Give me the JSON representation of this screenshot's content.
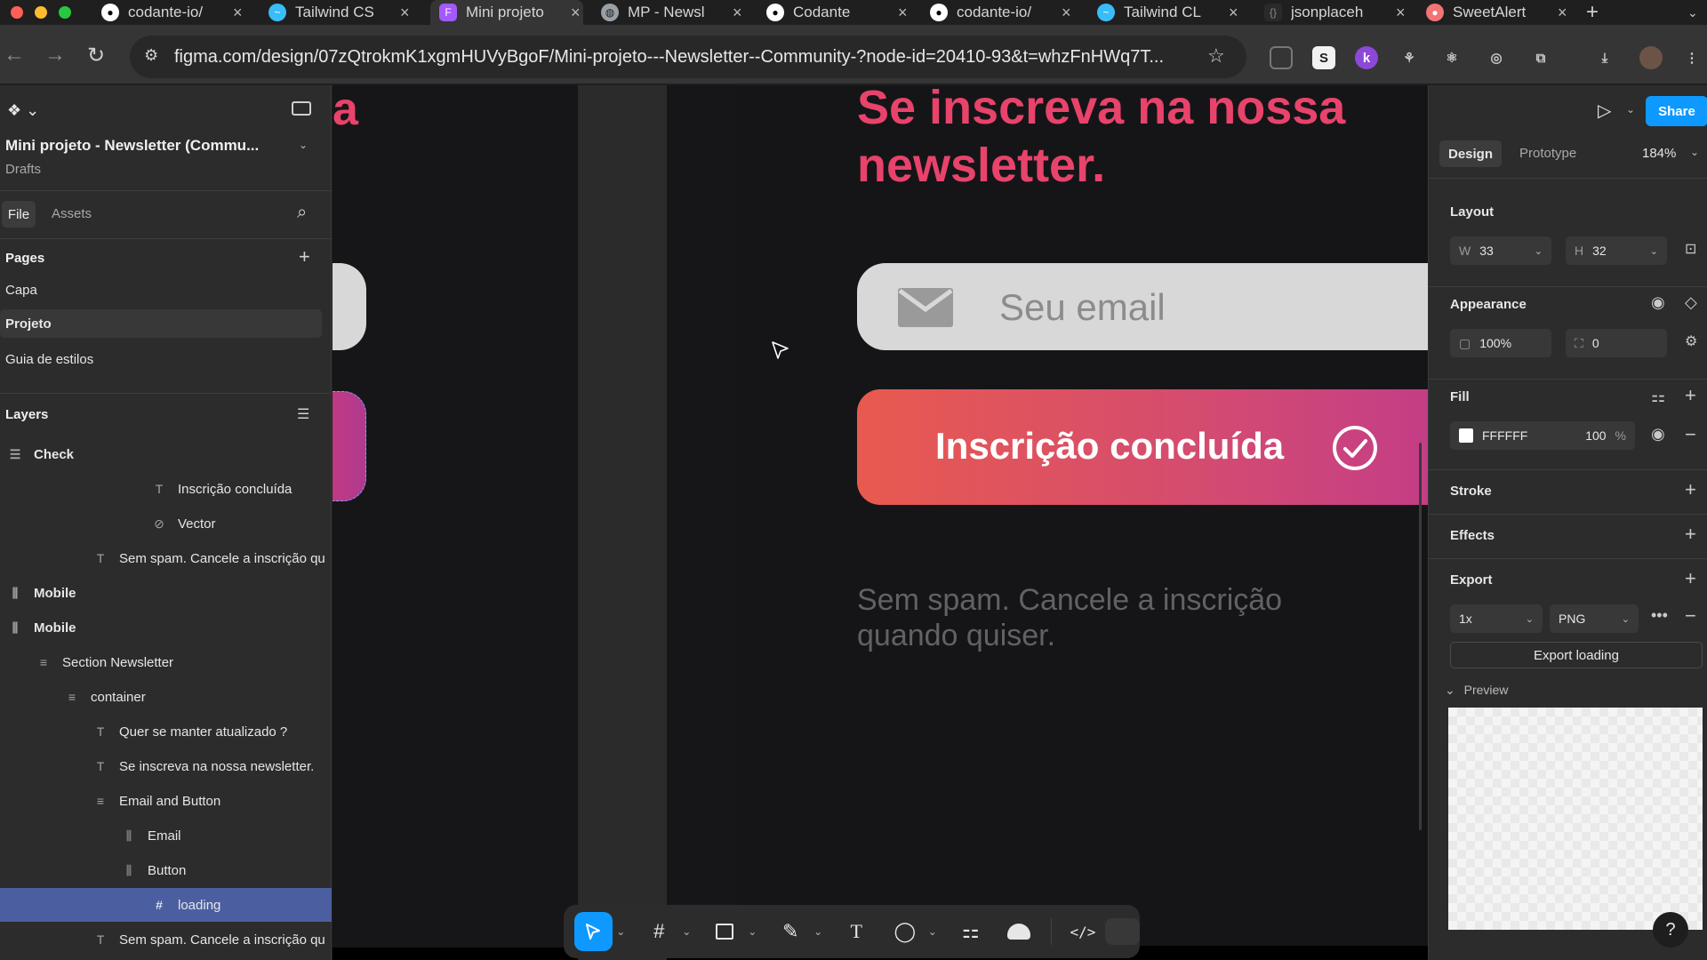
{
  "browser": {
    "tabs": [
      {
        "label": "codante-io/",
        "icon": "github-icon"
      },
      {
        "label": "Tailwind CS",
        "icon": "tailwind-icon"
      },
      {
        "label": "Mini projeto",
        "icon": "figma-icon",
        "active": true
      },
      {
        "label": "MP - Newsl",
        "icon": "globe-icon"
      },
      {
        "label": "Codante",
        "icon": "github-icon"
      },
      {
        "label": "codante-io/",
        "icon": "github-icon"
      },
      {
        "label": "Tailwind CL",
        "icon": "tailwind-icon"
      },
      {
        "label": "jsonplaceh",
        "icon": "json-icon"
      },
      {
        "label": "SweetAlert",
        "icon": "sweetalert-icon"
      }
    ],
    "url": "figma.com/design/07zQtrokmK1xgmHUVyBgoF/Mini-projeto---Newsletter--Community-?node-id=20410-93&t=whzFnHWq7T..."
  },
  "leftPanel": {
    "fileTitle": "Mini projeto - Newsletter (Commu...",
    "fileSubtitle": "Drafts",
    "tabs": {
      "file": "File",
      "assets": "Assets"
    },
    "pagesTitle": "Pages",
    "pages": [
      "Capa",
      "Projeto",
      "Guia de estilos"
    ],
    "layersTitle": "Layers",
    "layers": [
      {
        "label": "Check",
        "icon": "frame-stack-icon",
        "bold": true
      },
      {
        "label": "Inscrição concluída",
        "icon": "text-icon"
      },
      {
        "label": "Vector",
        "icon": "vector-icon"
      },
      {
        "label": "Sem spam. Cancele a inscrição qu",
        "icon": "text-icon"
      },
      {
        "label": "Mobile",
        "icon": "component-frame-icon",
        "bold": true
      },
      {
        "label": "Mobile",
        "icon": "component-frame-icon",
        "bold": true
      },
      {
        "label": "Section Newsletter",
        "icon": "stack-icon"
      },
      {
        "label": "container",
        "icon": "stack-icon"
      },
      {
        "label": "Quer se manter atualizado ?",
        "icon": "text-icon"
      },
      {
        "label": "Se inscreva na nossa newsletter.",
        "icon": "text-icon"
      },
      {
        "label": "Email and Button",
        "icon": "stack-icon"
      },
      {
        "label": "Email",
        "icon": "component-frame-icon"
      },
      {
        "label": "Button",
        "icon": "component-frame-icon"
      },
      {
        "label": "loading",
        "icon": "hash-icon",
        "selected": true
      },
      {
        "label": "Sem spam. Cancele a inscrição qu",
        "icon": "text-icon"
      }
    ]
  },
  "canvas": {
    "leftHeadlineFragment": "a",
    "headlineLine1": "Se inscreva na nossa",
    "headlineLine2": "newsletter.",
    "emailPlaceholder": "Seu email",
    "buttonLabel": "Inscrição concluída",
    "noSpamLine1": "Sem spam. Cancele a inscrição",
    "noSpamLine2": "quando quiser.",
    "colors": {
      "headline": "#e8436b",
      "gradientStart": "#e85a4f",
      "gradientEnd": "#c03a8b",
      "selection": "#0d99ff"
    }
  },
  "rightPanel": {
    "tabs": {
      "design": "Design",
      "prototype": "Prototype"
    },
    "zoom": "184%",
    "share": "Share",
    "layout": {
      "title": "Layout",
      "w": "33",
      "h": "32"
    },
    "appearance": {
      "title": "Appearance",
      "opacity": "100%",
      "radius": "0"
    },
    "fill": {
      "title": "Fill",
      "hex": "FFFFFF",
      "opacity": "100",
      "unit": "%"
    },
    "stroke": "Stroke",
    "effects": "Effects",
    "export": {
      "title": "Export",
      "scale": "1x",
      "format": "PNG",
      "button": "Export loading",
      "previewLabel": "Preview"
    }
  }
}
